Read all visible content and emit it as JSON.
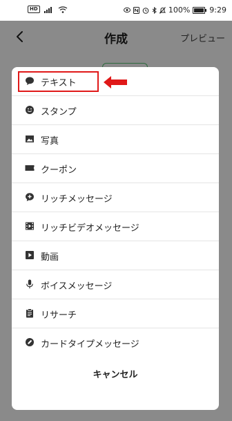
{
  "status_bar": {
    "hd": "HD",
    "battery_percent_label": "100%",
    "battery_level": 1.0,
    "time": "9:29"
  },
  "header": {
    "title": "作成",
    "preview": "プレビュー"
  },
  "menu": {
    "items": [
      {
        "label": "テキスト",
        "icon": "speech-bubble-icon"
      },
      {
        "label": "スタンプ",
        "icon": "smiley-icon"
      },
      {
        "label": "写真",
        "icon": "image-icon"
      },
      {
        "label": "クーポン",
        "icon": "ticket-icon"
      },
      {
        "label": "リッチメッセージ",
        "icon": "rich-message-icon"
      },
      {
        "label": "リッチビデオメッセージ",
        "icon": "film-icon"
      },
      {
        "label": "動画",
        "icon": "play-icon"
      },
      {
        "label": "ボイスメッセージ",
        "icon": "microphone-icon"
      },
      {
        "label": "リサーチ",
        "icon": "clipboard-icon"
      },
      {
        "label": "カードタイプメッセージ",
        "icon": "card-icon"
      }
    ],
    "cancel": "キャンセル"
  },
  "colors": {
    "highlight": "#e01818",
    "backdrop": "#8a8a8a",
    "accent_green": "#2e6b3e"
  }
}
